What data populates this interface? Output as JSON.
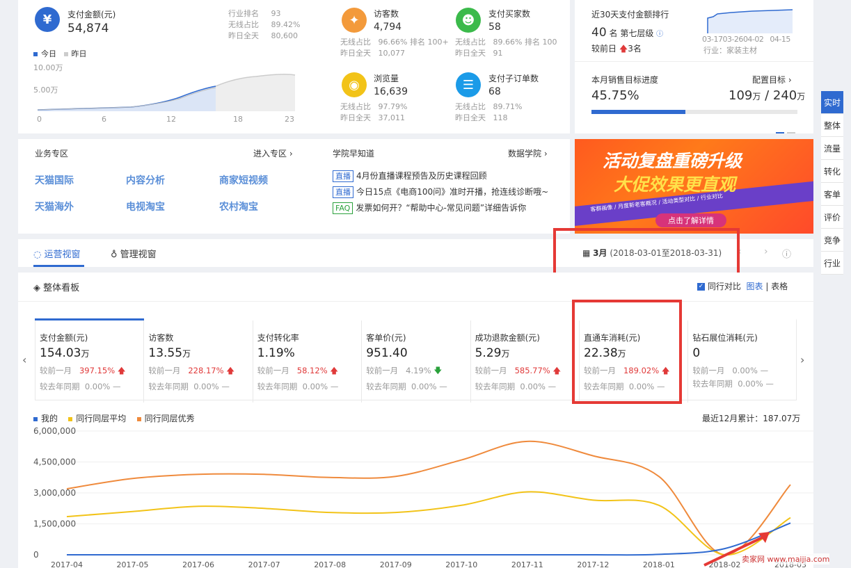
{
  "top_left": {
    "pay_label": "支付金额(元)",
    "pay_value": "54,874",
    "industry_rank_label": "行业排名",
    "industry_rank_value": "93",
    "wireless_label": "无线占比",
    "wireless_value": "89.42%",
    "yesterday_label": "昨日全天",
    "yesterday_value": "80,600",
    "legend_today": "今日",
    "legend_yesterday": "昨日",
    "y_ticks": [
      "10.00万",
      "5.00万"
    ],
    "x_ticks": [
      "0",
      "6",
      "12",
      "18",
      "23"
    ]
  },
  "stats": [
    {
      "label": "访客数",
      "value": "4,794",
      "r1l": "无线占比",
      "r1v": "96.66%",
      "r1x": "排名 100+",
      "r2l": "昨日全天",
      "r2v": "10,077",
      "icon": "footprint-icon",
      "color": "#f39a3b"
    },
    {
      "label": "支付买家数",
      "value": "58",
      "r1l": "无线占比",
      "r1v": "89.66%",
      "r1x": "排名 100",
      "r2l": "昨日全天",
      "r2v": "91",
      "icon": "users-icon",
      "color": "#3bba4b"
    },
    {
      "label": "浏览量",
      "value": "16,639",
      "r1l": "无线占比",
      "r1v": "97.79%",
      "r1x": "",
      "r2l": "昨日全天",
      "r2v": "37,011",
      "icon": "eye-icon",
      "color": "#f2c318"
    },
    {
      "label": "支付子订单数",
      "value": "68",
      "r1l": "无线占比",
      "r1v": "89.71%",
      "r1x": "",
      "r2l": "昨日全天",
      "r2v": "118",
      "icon": "order-icon",
      "color": "#1b9be8"
    }
  ],
  "ranking": {
    "title": "近30天支付金额排行",
    "rank": "40",
    "rank_unit": "名",
    "level": "第七层级",
    "compare_label": "较前日",
    "compare_value": "3名",
    "x_ticks": [
      "03-17",
      "03-26",
      "04-02",
      "04-15"
    ],
    "industry": "行业：家装主材"
  },
  "target": {
    "title": "本月销售目标进度",
    "config": "配置目标",
    "percent": "45.75%",
    "progress": 0.4575,
    "current": "109",
    "total": "240",
    "unit": "万"
  },
  "business": {
    "title": "业务专区",
    "enter": "进入专区",
    "links": [
      "天猫国际",
      "内容分析",
      "商家短视频",
      "天猫海外",
      "电视淘宝",
      "农村淘宝"
    ]
  },
  "academy": {
    "title": "学院早知道",
    "more": "数据学院",
    "items": [
      {
        "tag": "直播",
        "text": "4月份直播课程预告及历史课程回顾"
      },
      {
        "tag": "直播",
        "text": "今日15点《电商100问》准时开播，抢连线诊断哦~"
      },
      {
        "tag": "FAQ",
        "text": "发票如何开？“帮助中心-常见问题”详细告诉你"
      }
    ]
  },
  "banner": {
    "line1": "活动复盘重磅升级",
    "line2": "大促效果更直观",
    "sub": "客群画像 / 月度新老客概况 / 活动类型对比 / 行业对比",
    "cta": "点击了解详情"
  },
  "tabs": {
    "tab1": "运营视窗",
    "tab2": "管理视窗",
    "month": "3月",
    "range": "(2018-03-01至2018-03-31)"
  },
  "right_nav": [
    "实时",
    "整体",
    "流量",
    "转化",
    "客单",
    "评价",
    "竞争",
    "行业"
  ],
  "board": {
    "title": "整体看板",
    "peer_compare": "同行对比",
    "view_chart": "图表",
    "view_table": "表格",
    "summary": "最近12月累计：187.07万"
  },
  "kpis": [
    {
      "title": "支付金额(元)",
      "value": "154.03",
      "unit": "万",
      "m_label": "较前一月",
      "m_value": "397.15%",
      "m_dir": "up",
      "y_label": "较去年同期",
      "y_value": "0.00%",
      "y_dir": "—"
    },
    {
      "title": "访客数",
      "value": "13.55",
      "unit": "万",
      "m_label": "较前一月",
      "m_value": "228.17%",
      "m_dir": "up",
      "y_label": "较去年同期",
      "y_value": "0.00%",
      "y_dir": "—"
    },
    {
      "title": "支付转化率",
      "value": "1.19%",
      "unit": "",
      "m_label": "较前一月",
      "m_value": "58.12%",
      "m_dir": "up",
      "y_label": "较去年同期",
      "y_value": "0.00%",
      "y_dir": "—"
    },
    {
      "title": "客单价(元)",
      "value": "951.40",
      "unit": "",
      "m_label": "较前一月",
      "m_value": "4.19%",
      "m_dir": "down",
      "y_label": "较去年同期",
      "y_value": "0.00%",
      "y_dir": "—"
    },
    {
      "title": "成功退款金额(元)",
      "value": "5.29",
      "unit": "万",
      "m_label": "较前一月",
      "m_value": "585.77%",
      "m_dir": "up",
      "y_label": "较去年同期",
      "y_value": "0.00%",
      "y_dir": "—"
    },
    {
      "title": "直通车消耗(元)",
      "value": "22.38",
      "unit": "万",
      "m_label": "较前一月",
      "m_value": "189.02%",
      "m_dir": "up",
      "y_label": "较去年同期",
      "y_value": "0.00%",
      "y_dir": "—"
    },
    {
      "title": "钻石展位消耗(元)",
      "value": "0",
      "unit": "",
      "m_label": "较前一月",
      "m_value": "0.00%",
      "m_dir": "—",
      "y_label": "较去年同期",
      "y_value": "0.00%",
      "y_dir": "—"
    }
  ],
  "watermark": "卖家网 www.maijia.com",
  "chart_data": {
    "type": "line",
    "legend": [
      "我的",
      "同行同层平均",
      "同行同层优秀"
    ],
    "colors": [
      "#2f6ad0",
      "#f2c318",
      "#ef8a3c"
    ],
    "categories": [
      "2017-04",
      "2017-05",
      "2017-06",
      "2017-07",
      "2017-08",
      "2017-09",
      "2017-10",
      "2017-11",
      "2017-12",
      "2018-01",
      "2018-02",
      "2018-03"
    ],
    "series": [
      {
        "name": "我的",
        "values": [
          0,
          0,
          0,
          0,
          0,
          0,
          0,
          0,
          0,
          20000,
          300000,
          1540000
        ]
      },
      {
        "name": "同行同层平均",
        "values": [
          1850000,
          2100000,
          2350000,
          2250000,
          2050000,
          2050000,
          2400000,
          3050000,
          2650000,
          2400000,
          0,
          1800000
        ]
      },
      {
        "name": "同行同层优秀",
        "values": [
          3200000,
          3700000,
          3900000,
          3900000,
          3750000,
          3800000,
          4600000,
          5500000,
          4800000,
          3800000,
          0,
          3400000
        ]
      }
    ],
    "y_ticks": [
      "6,000,000",
      "4,500,000",
      "3,000,000",
      "1,500,000",
      "0"
    ],
    "ylim": [
      0,
      6000000
    ]
  }
}
